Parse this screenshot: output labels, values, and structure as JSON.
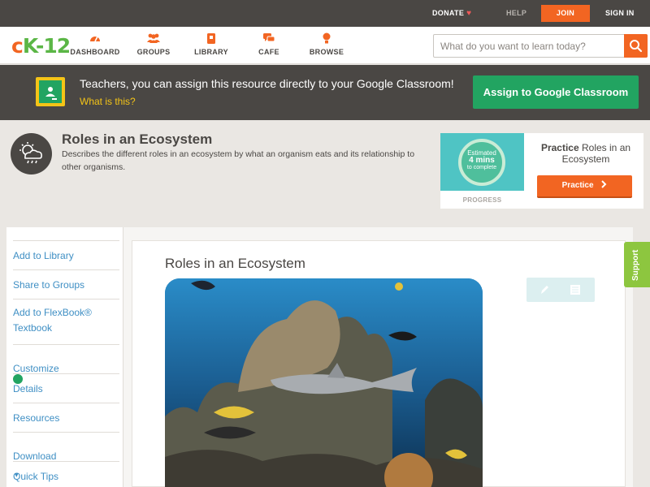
{
  "topbar": {
    "donate_label": "DONATE",
    "heart": "♥",
    "help_label": "HELP",
    "join_label": "JOIN",
    "signin_label": "SIGN IN"
  },
  "nav": {
    "logo_c": "c",
    "logo_k12": "K-12",
    "items": [
      {
        "label": "DASHBOARD",
        "icon": "dashboard-icon"
      },
      {
        "label": "GROUPS",
        "icon": "groups-icon"
      },
      {
        "label": "LIBRARY",
        "icon": "library-icon"
      },
      {
        "label": "CAFE",
        "icon": "cafe-icon"
      },
      {
        "label": "BROWSE",
        "icon": "browse-icon"
      }
    ],
    "search_placeholder": "What do you want to learn today?"
  },
  "banner": {
    "text": "Teachers, you can assign this resource directly to your Google Classroom!",
    "link": "What is this?",
    "button": "Assign to Google Classroom"
  },
  "header": {
    "title": "Roles in an Ecosystem",
    "description": "Describes the different roles in an ecosystem by what an organism eats and its relationship to other organisms."
  },
  "practice": {
    "estimated": "Estimated",
    "minutes": "4 mins",
    "to_complete": "to complete",
    "progress_label": "PROGRESS",
    "title_bold": "Practice",
    "title_rest": "Roles in an Ecosystem",
    "button": "Practice"
  },
  "sidebar": {
    "items": [
      {
        "label": "Add to Library"
      },
      {
        "label": "Share to Groups"
      },
      {
        "label": "Add to FlexBook® Textbook"
      },
      {
        "label": "Customize"
      },
      {
        "label": "Details"
      },
      {
        "label": "Resources"
      },
      {
        "label": "Download"
      }
    ],
    "download_caret": "▾",
    "quick_tips": "Quick Tips"
  },
  "main": {
    "title": "Roles in an Ecosystem"
  },
  "support": {
    "label": "Support"
  },
  "colors": {
    "brand_orange": "#f26522",
    "brand_green": "#5bb646",
    "classroom_green": "#22a461",
    "dark_bar": "#4a4744",
    "link_blue": "#3f8fc4"
  }
}
